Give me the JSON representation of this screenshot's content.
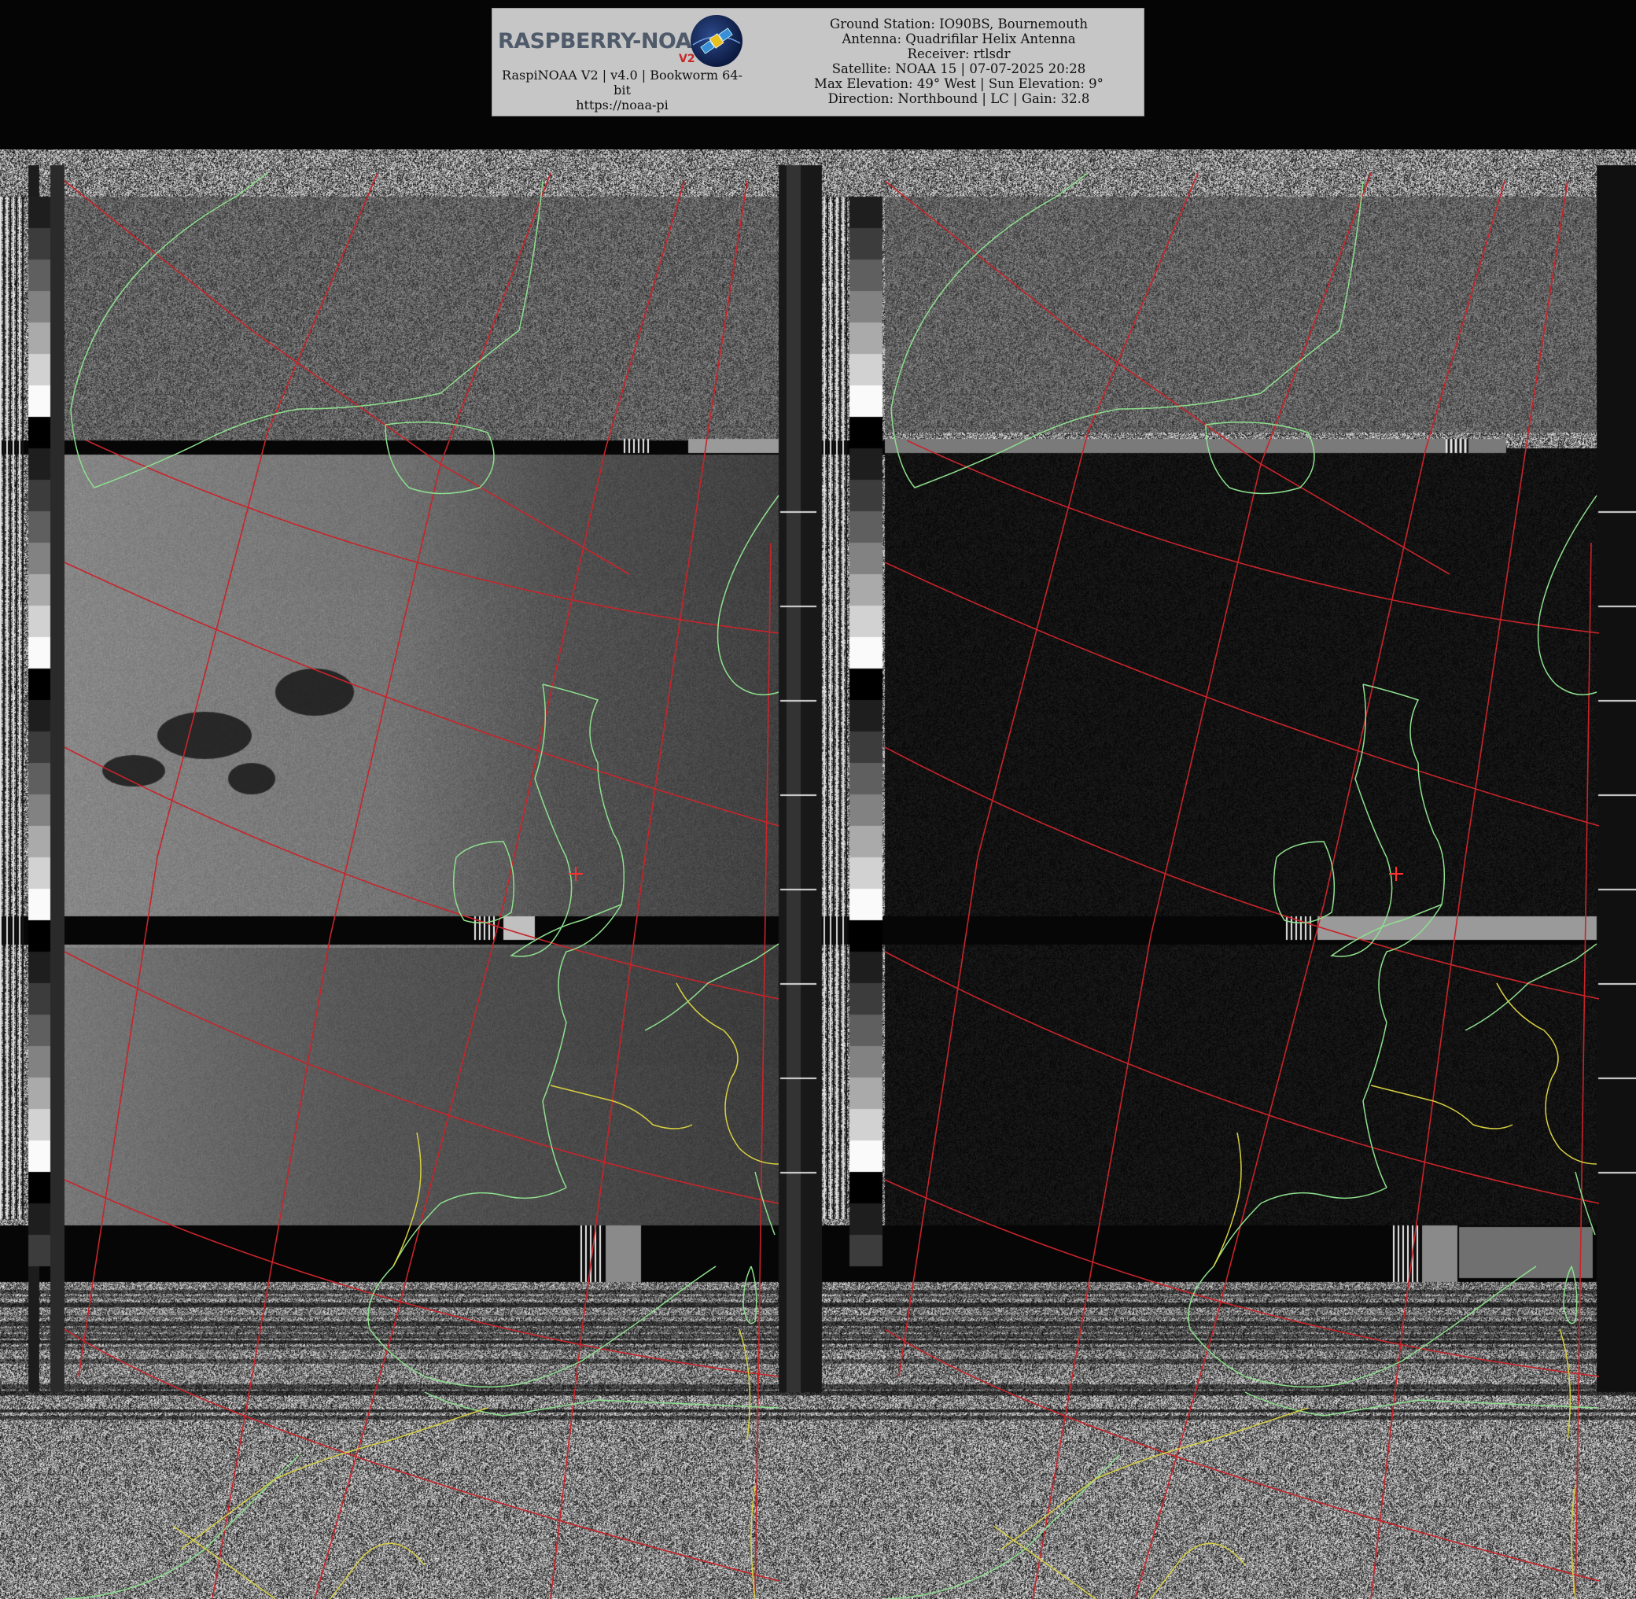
{
  "header": {
    "logo_text": "RASPBERRY-NOAA",
    "logo_version": "V2",
    "software_line": "RaspiNOAA V2 | v4.0 | Bookworm 64-bit",
    "url_line": "https://noaa-pi"
  },
  "pass_info": {
    "ground_station": "Ground Station: IO90BS, Bournemouth",
    "antenna": "Antenna: Quadrifilar Helix Antenna",
    "receiver": "Receiver: rtlsdr",
    "satellite": "Satellite: NOAA 15 | 07-07-2025 20:28",
    "elevation": "Max Elevation: 49° West | Sun Elevation: 9°",
    "direction": "Direction: Northbound | LC | Gain: 32.8"
  },
  "colors": {
    "grid_line": "#c8242a",
    "coastline": "#8ee08e",
    "border_line": "#d8d040",
    "station_marker": "#ff3030"
  },
  "icons": {
    "logo_icon": "satellite-globe-icon",
    "station_marker": "crosshair-icon"
  }
}
